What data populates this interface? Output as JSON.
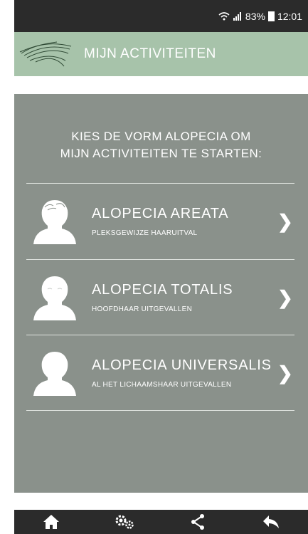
{
  "status_bar": {
    "battery_percent": "83%",
    "time": "12:01"
  },
  "app_bar": {
    "title": "MIJN ACTIVITEITEN",
    "colors": {
      "background": "#a7c3aa",
      "text": "#ffffff"
    }
  },
  "main": {
    "intro_line1": "KIES DE VORM ALOPECIA OM",
    "intro_line2": "MIJN ACTIVITEITEN TE STARTEN:",
    "background": "#8a918b",
    "options": [
      {
        "title": "ALOPECIA AREATA",
        "subtitle": "PLEKSGEWIJZE HAARUITVAL",
        "icon": "person-patchy-hair-icon"
      },
      {
        "title": "ALOPECIA TOTALIS",
        "subtitle": "HOOFDHAAR UITGEVALLEN",
        "icon": "person-bald-icon"
      },
      {
        "title": "ALOPECIA UNIVERSALIS",
        "subtitle": "AL HET LICHAAMSHAAR UITGEVALLEN",
        "icon": "person-silhouette-icon"
      }
    ]
  },
  "bottom_nav": {
    "items": [
      "home-icon",
      "settings-icon",
      "share-icon",
      "back-icon"
    ]
  }
}
